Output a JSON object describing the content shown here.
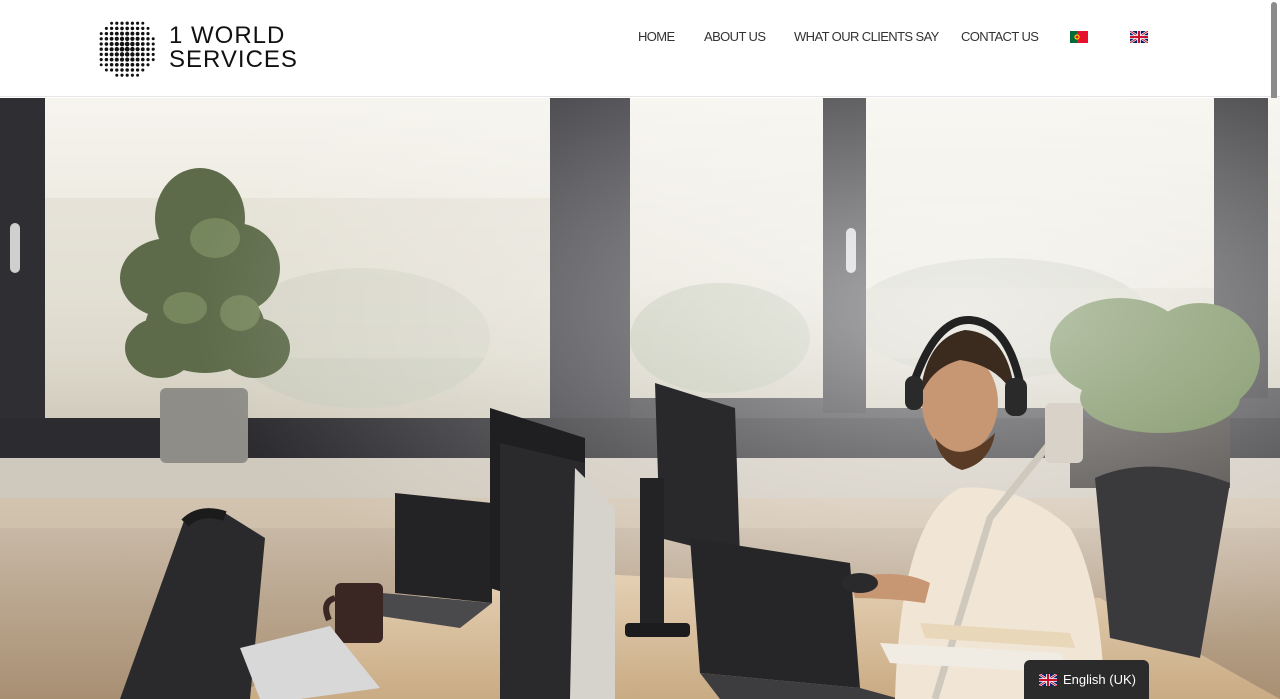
{
  "brand": {
    "logo_line1": "1 WORLD",
    "logo_line2": "SERVICES"
  },
  "nav": {
    "items": [
      {
        "label": "HOME"
      },
      {
        "label": "ABOUT US"
      },
      {
        "label": "WHAT OUR CLIENTS SAY"
      },
      {
        "label": "CONTACT US"
      }
    ],
    "flags": [
      "portugal-flag-icon",
      "uk-flag-icon"
    ]
  },
  "hero": {
    "image": "office-man-headphones-computer-desk"
  },
  "language_switcher": {
    "label": "English (UK)",
    "icon": "uk-flag-icon"
  },
  "colors": {
    "header_bg": "#ffffff",
    "nav_text": "#333333",
    "switcher_bg": "#2b2b2b"
  }
}
